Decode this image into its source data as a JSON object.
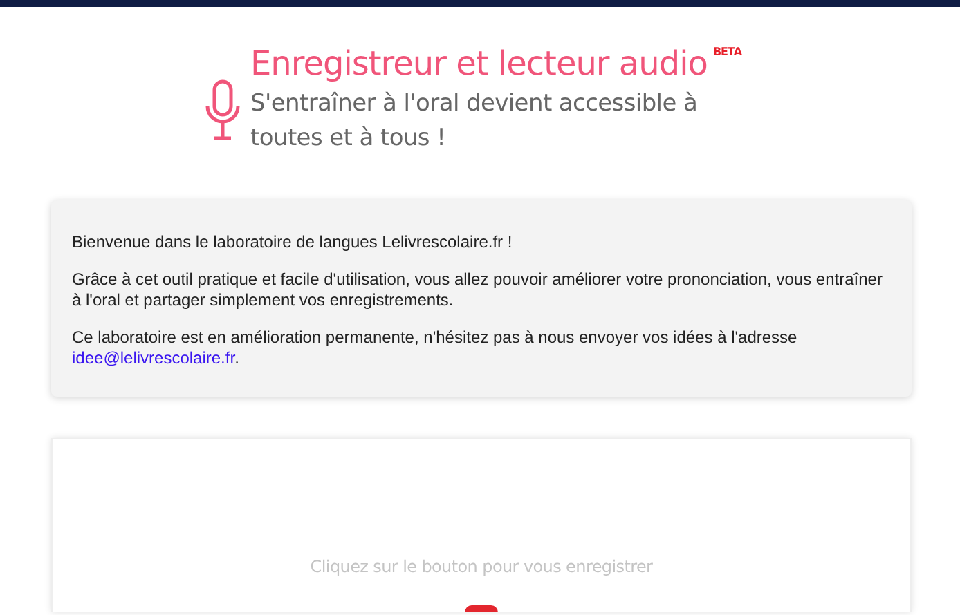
{
  "header": {
    "title": "Enregistreur et lecteur audio",
    "badge": "BETA",
    "subtitle": "S'entraîner à l'oral devient accessible à toutes et à tous !"
  },
  "info_card": {
    "paragraphs": [
      {
        "text": "Bienvenue dans le laboratoire de langues Lelivrescolaire.fr !"
      },
      {
        "text": "Grâce à cet outil pratique et facile d'utilisation, vous allez pouvoir améliorer votre prononciation, vous entraîner à l'oral et partager simplement vos enregistrements."
      },
      {
        "text": "Ce laboratoire est en amélioration permanente, n'hésitez pas à nous envoyer vos idées à l'adresse",
        "link": "idee@lelivrescolaire.fr",
        "after": "."
      }
    ]
  },
  "recorder": {
    "hint": "Cliquez sur le bouton pour vous enregistrer"
  }
}
